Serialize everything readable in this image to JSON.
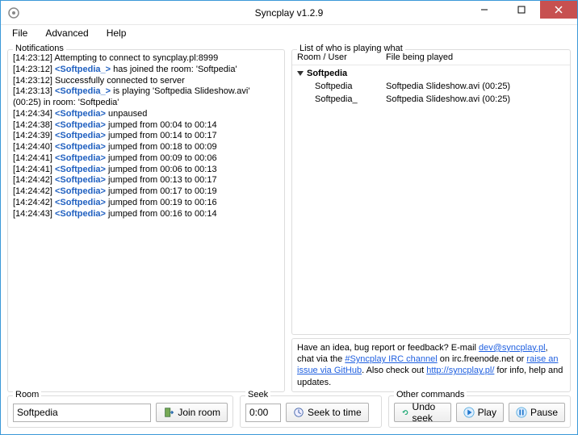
{
  "window": {
    "title": "Syncplay v1.2.9"
  },
  "menu": {
    "file": "File",
    "advanced": "Advanced",
    "help": "Help"
  },
  "notifications": {
    "label": "Notifications",
    "lines": [
      {
        "ts": "[14:23:12]",
        "user": "",
        "msg": "Attempting to connect to syncplay.pl:8999"
      },
      {
        "ts": "[14:23:12]",
        "user": "<Softpedia_>",
        "msg": "has joined the room: 'Softpedia'"
      },
      {
        "ts": "[14:23:12]",
        "user": "",
        "msg": "Successfully connected to server"
      },
      {
        "ts": "[14:23:13]",
        "user": "<Softpedia_>",
        "msg": "is playing 'Softpedia Slideshow.avi' (00:25) in room: 'Softpedia'"
      },
      {
        "ts": "[14:24:34]",
        "user": "<Softpedia>",
        "msg": "unpaused"
      },
      {
        "ts": "[14:24:38]",
        "user": "<Softpedia>",
        "msg": "jumped from 00:04 to 00:14"
      },
      {
        "ts": "[14:24:39]",
        "user": "<Softpedia>",
        "msg": "jumped from 00:14 to 00:17"
      },
      {
        "ts": "[14:24:40]",
        "user": "<Softpedia>",
        "msg": "jumped from 00:18 to 00:09"
      },
      {
        "ts": "[14:24:41]",
        "user": "<Softpedia>",
        "msg": "jumped from 00:09 to 00:06"
      },
      {
        "ts": "[14:24:41]",
        "user": "<Softpedia>",
        "msg": "jumped from 00:06 to 00:13"
      },
      {
        "ts": "[14:24:42]",
        "user": "<Softpedia>",
        "msg": "jumped from 00:13 to 00:17"
      },
      {
        "ts": "[14:24:42]",
        "user": "<Softpedia>",
        "msg": "jumped from 00:17 to 00:19"
      },
      {
        "ts": "[14:24:42]",
        "user": "<Softpedia>",
        "msg": "jumped from 00:19 to 00:16"
      },
      {
        "ts": "[14:24:43]",
        "user": "<Softpedia>",
        "msg": "jumped from 00:16 to 00:14"
      }
    ]
  },
  "userlist": {
    "label": "List of who is playing what",
    "col1": "Room / User",
    "col2": "File being played",
    "room": "Softpedia",
    "rows": [
      {
        "name": "Softpedia",
        "file": "Softpedia Slideshow.avi (00:25)"
      },
      {
        "name": "Softpedia_",
        "file": "Softpedia Slideshow.avi (00:25)"
      }
    ]
  },
  "feedback": {
    "t1": "Have an idea, bug report or feedback? E-mail ",
    "l1": "dev@syncplay.pl",
    "t2": ", chat via the ",
    "l2": "#Syncplay IRC channel",
    "t3": " on irc.freenode.net or ",
    "l3": "raise an issue via GitHub",
    "t4": ". Also check out ",
    "l4": "http://syncplay.pl/",
    "t5": " for info, help and updates."
  },
  "room": {
    "label": "Room",
    "value": "Softpedia",
    "join": "Join room"
  },
  "seek": {
    "label": "Seek",
    "value": "0:00",
    "btn": "Seek to time"
  },
  "other": {
    "label": "Other commands",
    "undo": "Undo seek",
    "play": "Play",
    "pause": "Pause"
  }
}
